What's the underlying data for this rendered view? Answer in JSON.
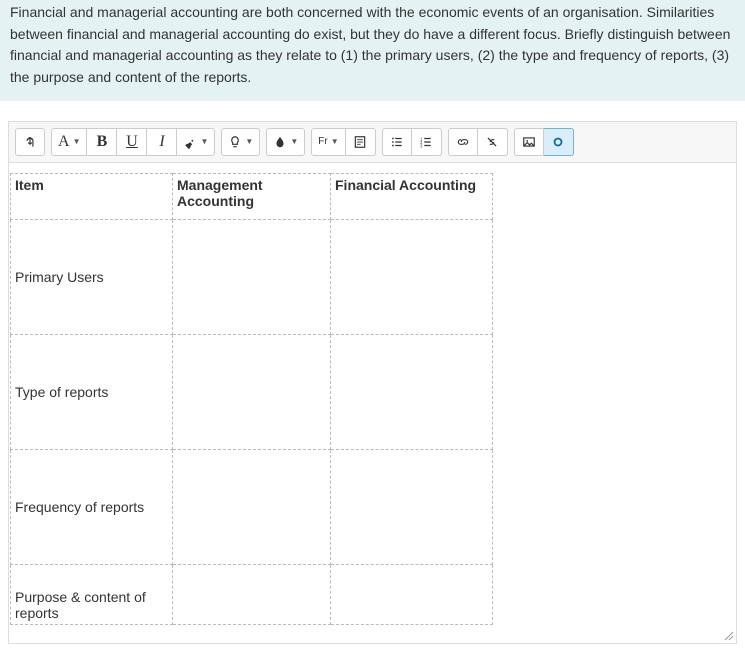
{
  "question": "Financial and managerial accounting are both concerned with the economic events of an organisation. Similarities between financial and managerial accounting do exist, but they do have a different focus. Briefly distinguish between financial and managerial accounting as they relate to (1) the primary users, (2) the type and frequency of reports, (3) the purpose and content of the reports.",
  "toolbar": {
    "font_style_label": "A",
    "bold_label": "B",
    "underline_label": "U",
    "italic_label": "I",
    "font_family_label": "Fr"
  },
  "table": {
    "headers": [
      "Item",
      "Management Accounting",
      "Financial Accounting"
    ],
    "rows": [
      {
        "label": "Primary Users",
        "mgmt": "",
        "fin": ""
      },
      {
        "label": "Type of reports",
        "mgmt": "",
        "fin": ""
      },
      {
        "label": "Frequency of reports",
        "mgmt": "",
        "fin": ""
      },
      {
        "label": "Purpose & content of reports",
        "mgmt": "",
        "fin": ""
      }
    ]
  }
}
